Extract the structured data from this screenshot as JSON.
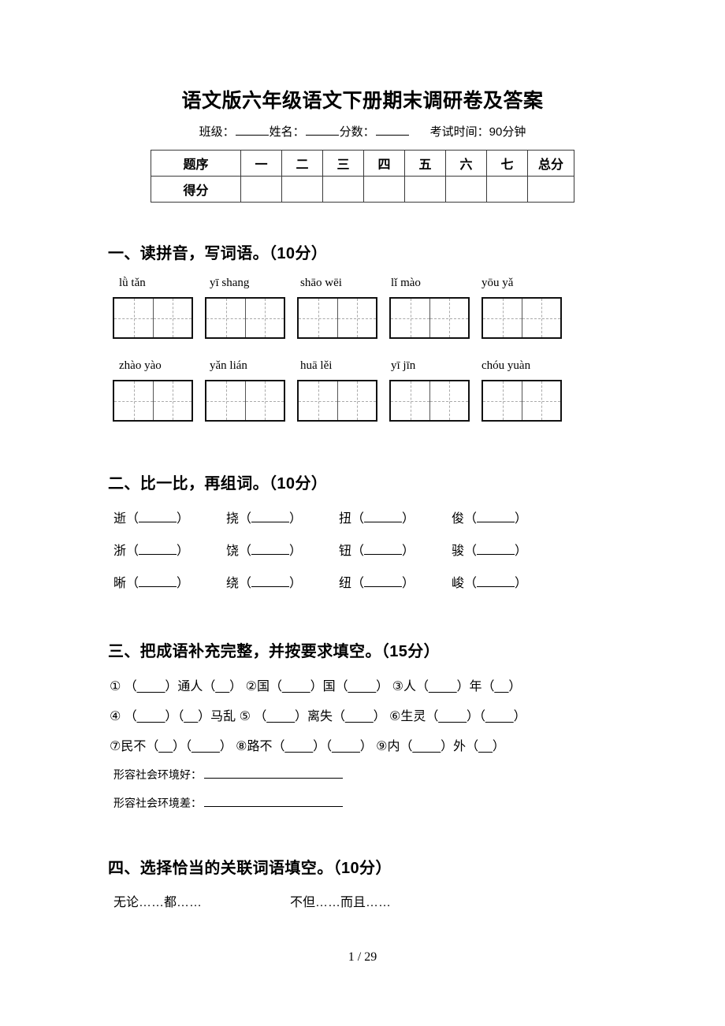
{
  "document": {
    "title": "语文版六年级语文下册期末调研卷及答案",
    "info": {
      "class_label": "班级：",
      "name_label": "姓名：",
      "score_label": "分数：",
      "time_label": "考试时间：90分钟"
    },
    "footer": "1 / 29"
  },
  "score_table": {
    "row_labels": [
      "题序",
      "得分"
    ],
    "columns": [
      "一",
      "二",
      "三",
      "四",
      "五",
      "六",
      "七",
      "总分"
    ],
    "scores": [
      "",
      "",
      "",
      "",
      "",
      "",
      "",
      ""
    ]
  },
  "sections": [
    {
      "heading": "一、读拼音，写词语。（10分）",
      "pinyin_rows": [
        [
          "lǜ tǎn",
          "yī shang",
          "shāo wēi",
          "lǐ mào",
          "yōu yǎ"
        ],
        [
          "zhào yào",
          "yǎn lián",
          "huā lěi",
          "yī jīn",
          "chóu yuàn"
        ]
      ]
    },
    {
      "heading": "二、比一比，再组词。（10分）",
      "rows": [
        [
          "逝",
          "挠",
          "扭",
          "俊"
        ],
        [
          "浙",
          "饶",
          "钮",
          "骏"
        ],
        [
          "晰",
          "绕",
          "纽",
          "峻"
        ]
      ]
    },
    {
      "heading": "三、把成语补充完整，并按要求填空。（15分）",
      "idiom_lines": [
        "① （____）通人（__）  ②国（____）国（____）  ③人（____）年（__）",
        "④ （____）（__）马乱  ⑤ （____）离失（____）  ⑥生灵（____）（____）",
        "⑦民不（__）（____）   ⑧路不（____）（____）   ⑨内（____）外（__）"
      ],
      "prompts": [
        "形容社会环境好：",
        "形容社会环境差："
      ]
    },
    {
      "heading": "四、选择恰当的关联词语填空。（10分）",
      "conjunctions": [
        "无论……都……",
        "不但……而且……"
      ]
    }
  ]
}
